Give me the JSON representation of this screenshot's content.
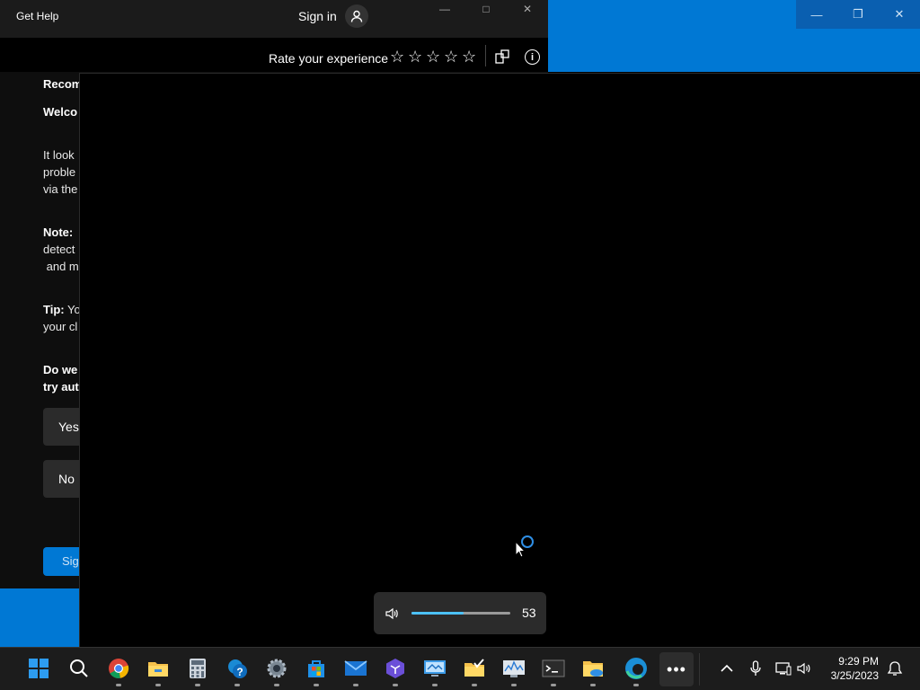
{
  "background_window": {
    "accent_color": "#0078d4",
    "controls": [
      "minimize-icon",
      "restore-icon",
      "close-icon"
    ]
  },
  "get_help": {
    "title": "Get Help",
    "sign_in_label": "Sign in",
    "rate_label": "Rate your experience",
    "star_count": 5,
    "content": {
      "recommended_heading": "Recom",
      "welcome_heading": "Welco",
      "para1": [
        "It look",
        "proble",
        "via the"
      ],
      "note_label": "Note:",
      "note_lines": [
        "detect",
        " and m"
      ],
      "tip_label": "Tip:",
      "tip_line1": " Yo",
      "tip_line2": "your cl",
      "question_lines": [
        "Do we",
        "try aut"
      ],
      "yes_label": "Yes",
      "no_label": "No",
      "sign_in_button_label": "Sig"
    }
  },
  "volume_flyout": {
    "level": 53,
    "level_text": "53",
    "accent_color": "#4cc2ff"
  },
  "taskbar": {
    "apps": [
      {
        "name": "start-icon",
        "active": false
      },
      {
        "name": "search-icon",
        "active": false
      },
      {
        "name": "chrome-icon",
        "active": true
      },
      {
        "name": "file-explorer-icon",
        "active": true
      },
      {
        "name": "calculator-icon",
        "active": true
      },
      {
        "name": "get-help-icon",
        "active": true
      },
      {
        "name": "settings-icon",
        "active": true
      },
      {
        "name": "microsoft-store-icon",
        "active": true
      },
      {
        "name": "mail-icon",
        "active": true
      },
      {
        "name": "visual-studio-icon",
        "active": true
      },
      {
        "name": "remote-desktop-icon",
        "active": true
      },
      {
        "name": "folder-check-icon",
        "active": true
      },
      {
        "name": "performance-monitor-icon",
        "active": true
      },
      {
        "name": "terminal-icon",
        "active": true
      },
      {
        "name": "folder-cloud-icon",
        "active": true
      },
      {
        "name": "edge-icon",
        "active": true
      }
    ],
    "overflow_label": "•••",
    "clock_time": "9:29 PM",
    "clock_date": "3/25/2023"
  }
}
